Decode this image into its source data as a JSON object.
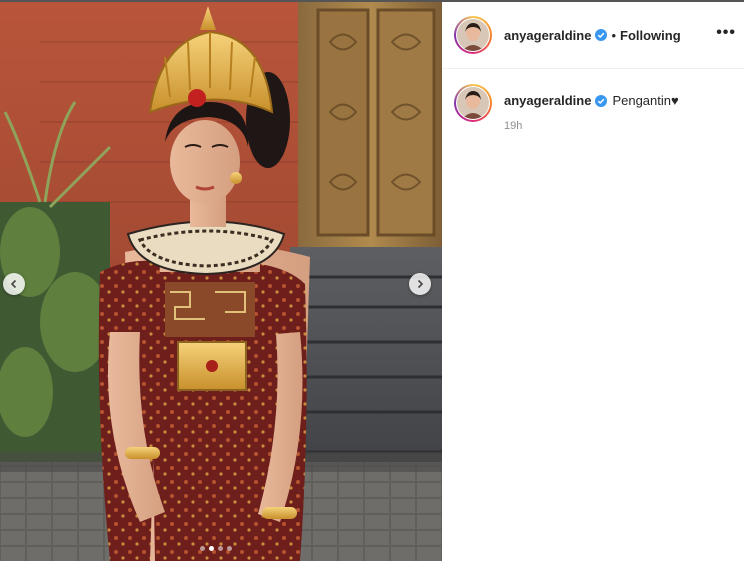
{
  "post": {
    "username": "anyageraldine",
    "separator": "•",
    "follow_status": "Following",
    "more_label": "•••",
    "caption_username": "anyageraldine",
    "caption_text": "Pengantin♥",
    "timestamp": "19h"
  },
  "carousel": {
    "slide_count": 4,
    "active_slide": 2
  },
  "colors": {
    "verified": "#3897f0",
    "text": "#262626",
    "muted": "#8e8e8e"
  },
  "icons": {
    "prev": "chevron-left-icon",
    "next": "chevron-right-icon",
    "verified": "verified-badge-icon",
    "more": "more-options-icon"
  }
}
